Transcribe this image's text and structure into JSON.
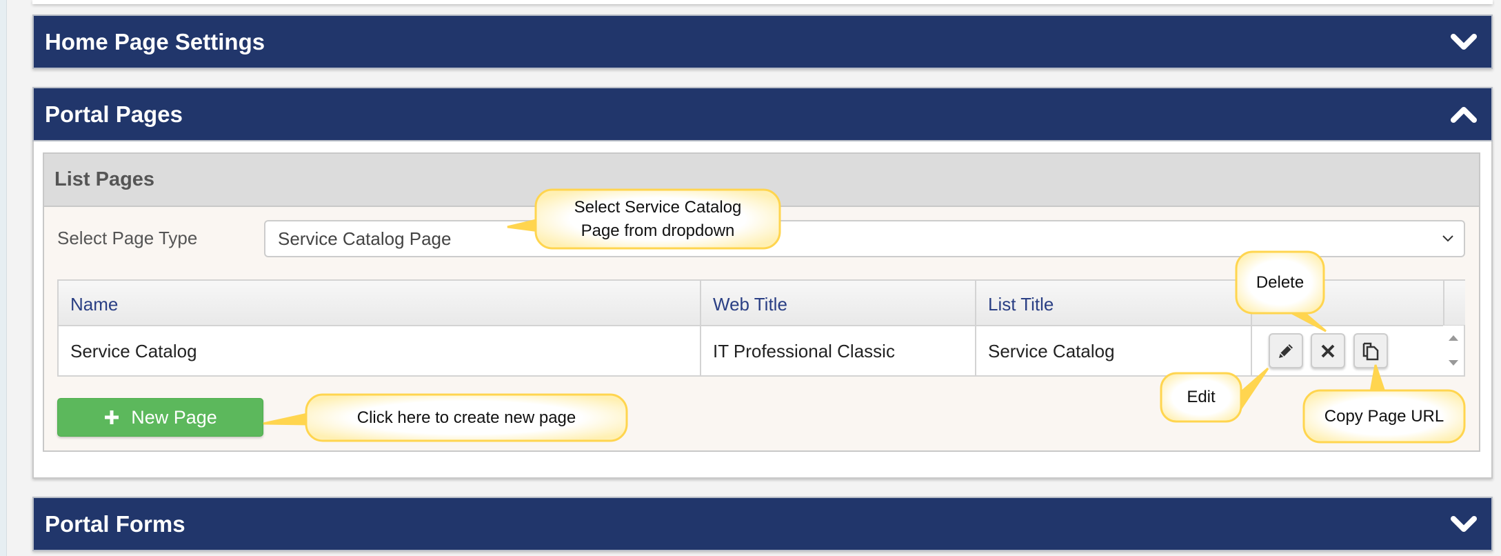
{
  "sections": {
    "home_page_settings": {
      "title": "Home Page Settings",
      "state": "collapsed"
    },
    "portal_pages": {
      "title": "Portal Pages",
      "state": "expanded"
    },
    "portal_forms": {
      "title": "Portal Forms",
      "state": "collapsed"
    }
  },
  "list_pages": {
    "title": "List Pages",
    "select_label": "Select Page Type",
    "select_value": "Service Catalog Page",
    "columns": [
      "Name",
      "Web Title",
      "List Title"
    ],
    "rows": [
      {
        "name": "Service Catalog",
        "web_title": "IT Professional Classic",
        "list_title": "Service Catalog"
      }
    ],
    "actions": {
      "edit": "pencil-icon",
      "delete": "close-icon",
      "copy": "copy-icon"
    },
    "new_page_label": "New Page"
  },
  "callouts": {
    "select_line1": "Select Service Catalog",
    "select_line2": "Page from dropdown",
    "delete": "Delete",
    "edit": "Edit",
    "copy": "Copy Page URL",
    "new_page": "Click here to create new page"
  },
  "colors": {
    "header": "#21366b",
    "new_button": "#5cb85c",
    "callout_border": "#ffd54f"
  }
}
